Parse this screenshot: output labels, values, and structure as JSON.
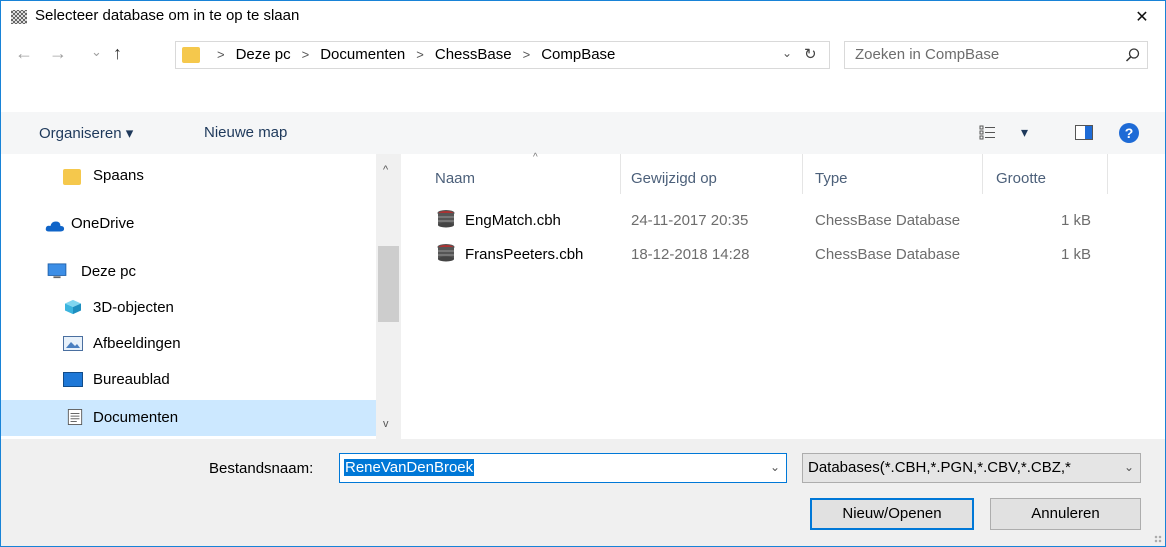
{
  "window": {
    "title": "Selecteer database om in te op te slaan",
    "close_glyph": "✕"
  },
  "nav": {
    "back_glyph": "←",
    "forward_glyph": "→",
    "history_glyph": "⌄",
    "up_glyph": "↑",
    "breadcrumbs": [
      "Deze pc",
      "Documenten",
      "ChessBase",
      "CompBase"
    ],
    "crumb_separator": ">",
    "dropdown_glyph": "⌄",
    "refresh_glyph": "↻",
    "search_placeholder": "Zoeken in CompBase"
  },
  "toolbar": {
    "organize_label": "Organiseren ▾",
    "new_folder_label": "Nieuwe map",
    "view_dropdown_glyph": "▾",
    "help_glyph": "?"
  },
  "tree": {
    "items": [
      {
        "label": "Spaans",
        "icon": "folder-icon"
      },
      {
        "label": "OneDrive",
        "icon": "onedrive-icon"
      },
      {
        "label": "Deze pc",
        "icon": "computer-icon"
      },
      {
        "label": "3D-objecten",
        "icon": "cube-icon"
      },
      {
        "label": "Afbeeldingen",
        "icon": "pictures-icon"
      },
      {
        "label": "Bureaublad",
        "icon": "desktop-icon"
      },
      {
        "label": "Documenten",
        "icon": "documents-icon",
        "selected": true
      }
    ],
    "scroll_up_glyph": "^",
    "scroll_down_glyph": "v"
  },
  "filelist": {
    "columns": [
      "Naam",
      "Gewijzigd op",
      "Type",
      "Grootte"
    ],
    "sort_glyph": "^",
    "rows": [
      {
        "name": "EngMatch.cbh",
        "modified": "24-11-2017 20:35",
        "type": "ChessBase Database",
        "size": "1 kB"
      },
      {
        "name": "FransPeeters.cbh",
        "modified": "18-12-2018 14:28",
        "type": "ChessBase Database",
        "size": "1 kB"
      }
    ]
  },
  "footer": {
    "filename_label": "Bestandsnaam:",
    "filename_value": "ReneVanDenBroek",
    "filename_dd_glyph": "⌄",
    "filter_value": "Databases(*.CBH,*.PGN,*.CBV,*.CBZ,*",
    "filter_dd_glyph": "⌄",
    "open_label": "Nieuw/Openen",
    "cancel_label": "Annuleren"
  },
  "colors": {
    "accent": "#0078d7",
    "selection": "#cce8ff",
    "column_header": "#4c607a"
  }
}
